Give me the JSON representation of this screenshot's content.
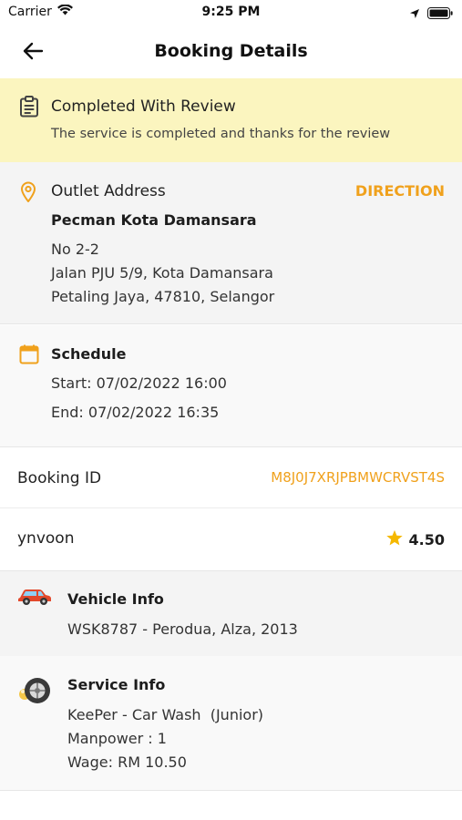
{
  "status_bar": {
    "carrier": "Carrier",
    "time": "9:25 PM"
  },
  "nav": {
    "title": "Booking Details"
  },
  "status_banner": {
    "title": "Completed With Review",
    "message": "The service is completed and thanks for the review"
  },
  "outlet": {
    "label": "Outlet Address",
    "direction_label": "DIRECTION",
    "name": "Pecman Kota Damansara",
    "address_line1": "No 2-2",
    "address_line2": "Jalan PJU 5/9, Kota Damansara",
    "address_line3": "Petaling Jaya, 47810, Selangor"
  },
  "schedule": {
    "label": "Schedule",
    "start": "Start: 07/02/2022 16:00",
    "end": "End: 07/02/2022 16:35"
  },
  "booking": {
    "label": "Booking ID",
    "id": "M8J0J7XRJPBMWCRVST4S"
  },
  "user": {
    "name": "ynvoon",
    "rating": "4.50"
  },
  "vehicle": {
    "label": "Vehicle Info",
    "details": "WSK8787 - Perodua, Alza, 2013"
  },
  "service": {
    "label": "Service Info",
    "name": "KeePer - Car Wash  (Junior)",
    "manpower": "Manpower : 1",
    "wage": "Wage: RM 10.50"
  },
  "colors": {
    "accent": "#f0a11c",
    "banner_bg": "#fbf5bf",
    "star": "#f5b800",
    "car": "#e2482b"
  },
  "icons": {
    "back": "arrow-left-icon",
    "status": "clipboard-icon",
    "outlet": "location-pin-icon",
    "schedule": "calendar-icon",
    "rating": "star-icon",
    "vehicle": "car-icon",
    "service": "tire-icon"
  }
}
